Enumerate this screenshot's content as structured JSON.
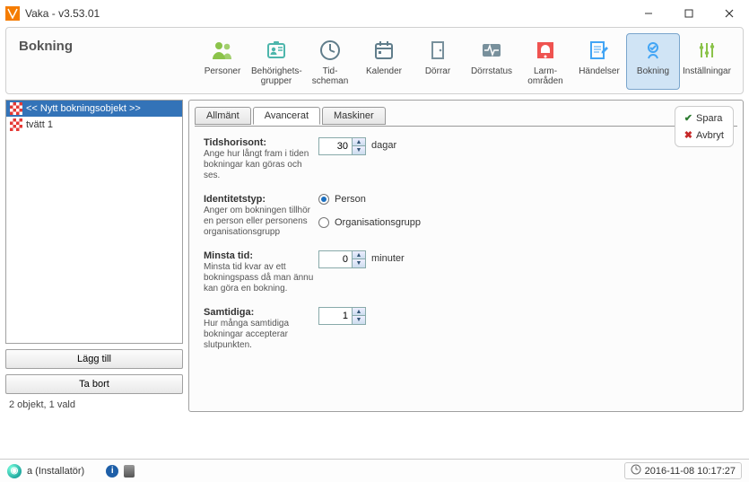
{
  "window": {
    "title": "Vaka - v3.53.01"
  },
  "section_title": "Bokning",
  "toolbar": [
    {
      "name": "personer",
      "label": "Personer",
      "icon": "people",
      "color": "#8bc34a"
    },
    {
      "name": "behorighet",
      "label": "Behörighets-\ngrupper",
      "icon": "id-badge",
      "color": "#4db6ac"
    },
    {
      "name": "tidscheman",
      "label": "Tid-\nscheman",
      "icon": "clock",
      "color": "#607d8b"
    },
    {
      "name": "kalender",
      "label": "Kalender",
      "icon": "calendar",
      "color": "#607d8b"
    },
    {
      "name": "dorrar",
      "label": "Dörrar",
      "icon": "door",
      "color": "#78909c"
    },
    {
      "name": "dorrstatus",
      "label": "Dörrstatus",
      "icon": "pulse",
      "color": "#78909c"
    },
    {
      "name": "larm",
      "label": "Larm-\nområden",
      "icon": "alarm",
      "color": "#ef5350"
    },
    {
      "name": "handelser",
      "label": "Händelser",
      "icon": "edit",
      "color": "#42a5f5"
    },
    {
      "name": "bokning",
      "label": "Bokning",
      "icon": "booking",
      "color": "#42a5f5",
      "active": true
    },
    {
      "name": "installningar",
      "label": "Inställningar",
      "icon": "sliders",
      "color": "#8bc34a"
    }
  ],
  "left_panel": {
    "items": [
      {
        "label": "<< Nytt bokningsobjekt >>",
        "selected": true
      },
      {
        "label": "tvätt 1",
        "selected": false
      }
    ],
    "add_label": "Lägg till",
    "remove_label": "Ta bort",
    "status": "2 objekt, 1 vald"
  },
  "tabs": [
    {
      "id": "allmant",
      "label": "Allmänt",
      "active": false
    },
    {
      "id": "avancerat",
      "label": "Avancerat",
      "active": true
    },
    {
      "id": "maskiner",
      "label": "Maskiner",
      "active": false
    }
  ],
  "form": {
    "tidshorisont": {
      "title": "Tidshorisont:",
      "desc": "Ange hur långt fram i tiden bokningar kan göras och ses.",
      "value": "30",
      "unit": "dagar"
    },
    "identitetstyp": {
      "title": "Identitetstyp:",
      "desc": "Anger om bokningen tillhör en person eller personens organisationsgrupp",
      "options": [
        "Person",
        "Organisationsgrupp"
      ],
      "selected": "Person"
    },
    "minsta_tid": {
      "title": "Minsta tid:",
      "desc": "Minsta tid kvar av ett bokningspass då man ännu kan göra en bokning.",
      "value": "0",
      "unit": "minuter"
    },
    "samtidiga": {
      "title": "Samtidiga:",
      "desc": "Hur många samtidiga bokningar accepterar slutpunkten.",
      "value": "1"
    }
  },
  "actions": {
    "save": "Spara",
    "cancel": "Avbryt"
  },
  "statusbar": {
    "user": "a (Installatör)",
    "datetime": "2016-11-08 10:17:27"
  }
}
